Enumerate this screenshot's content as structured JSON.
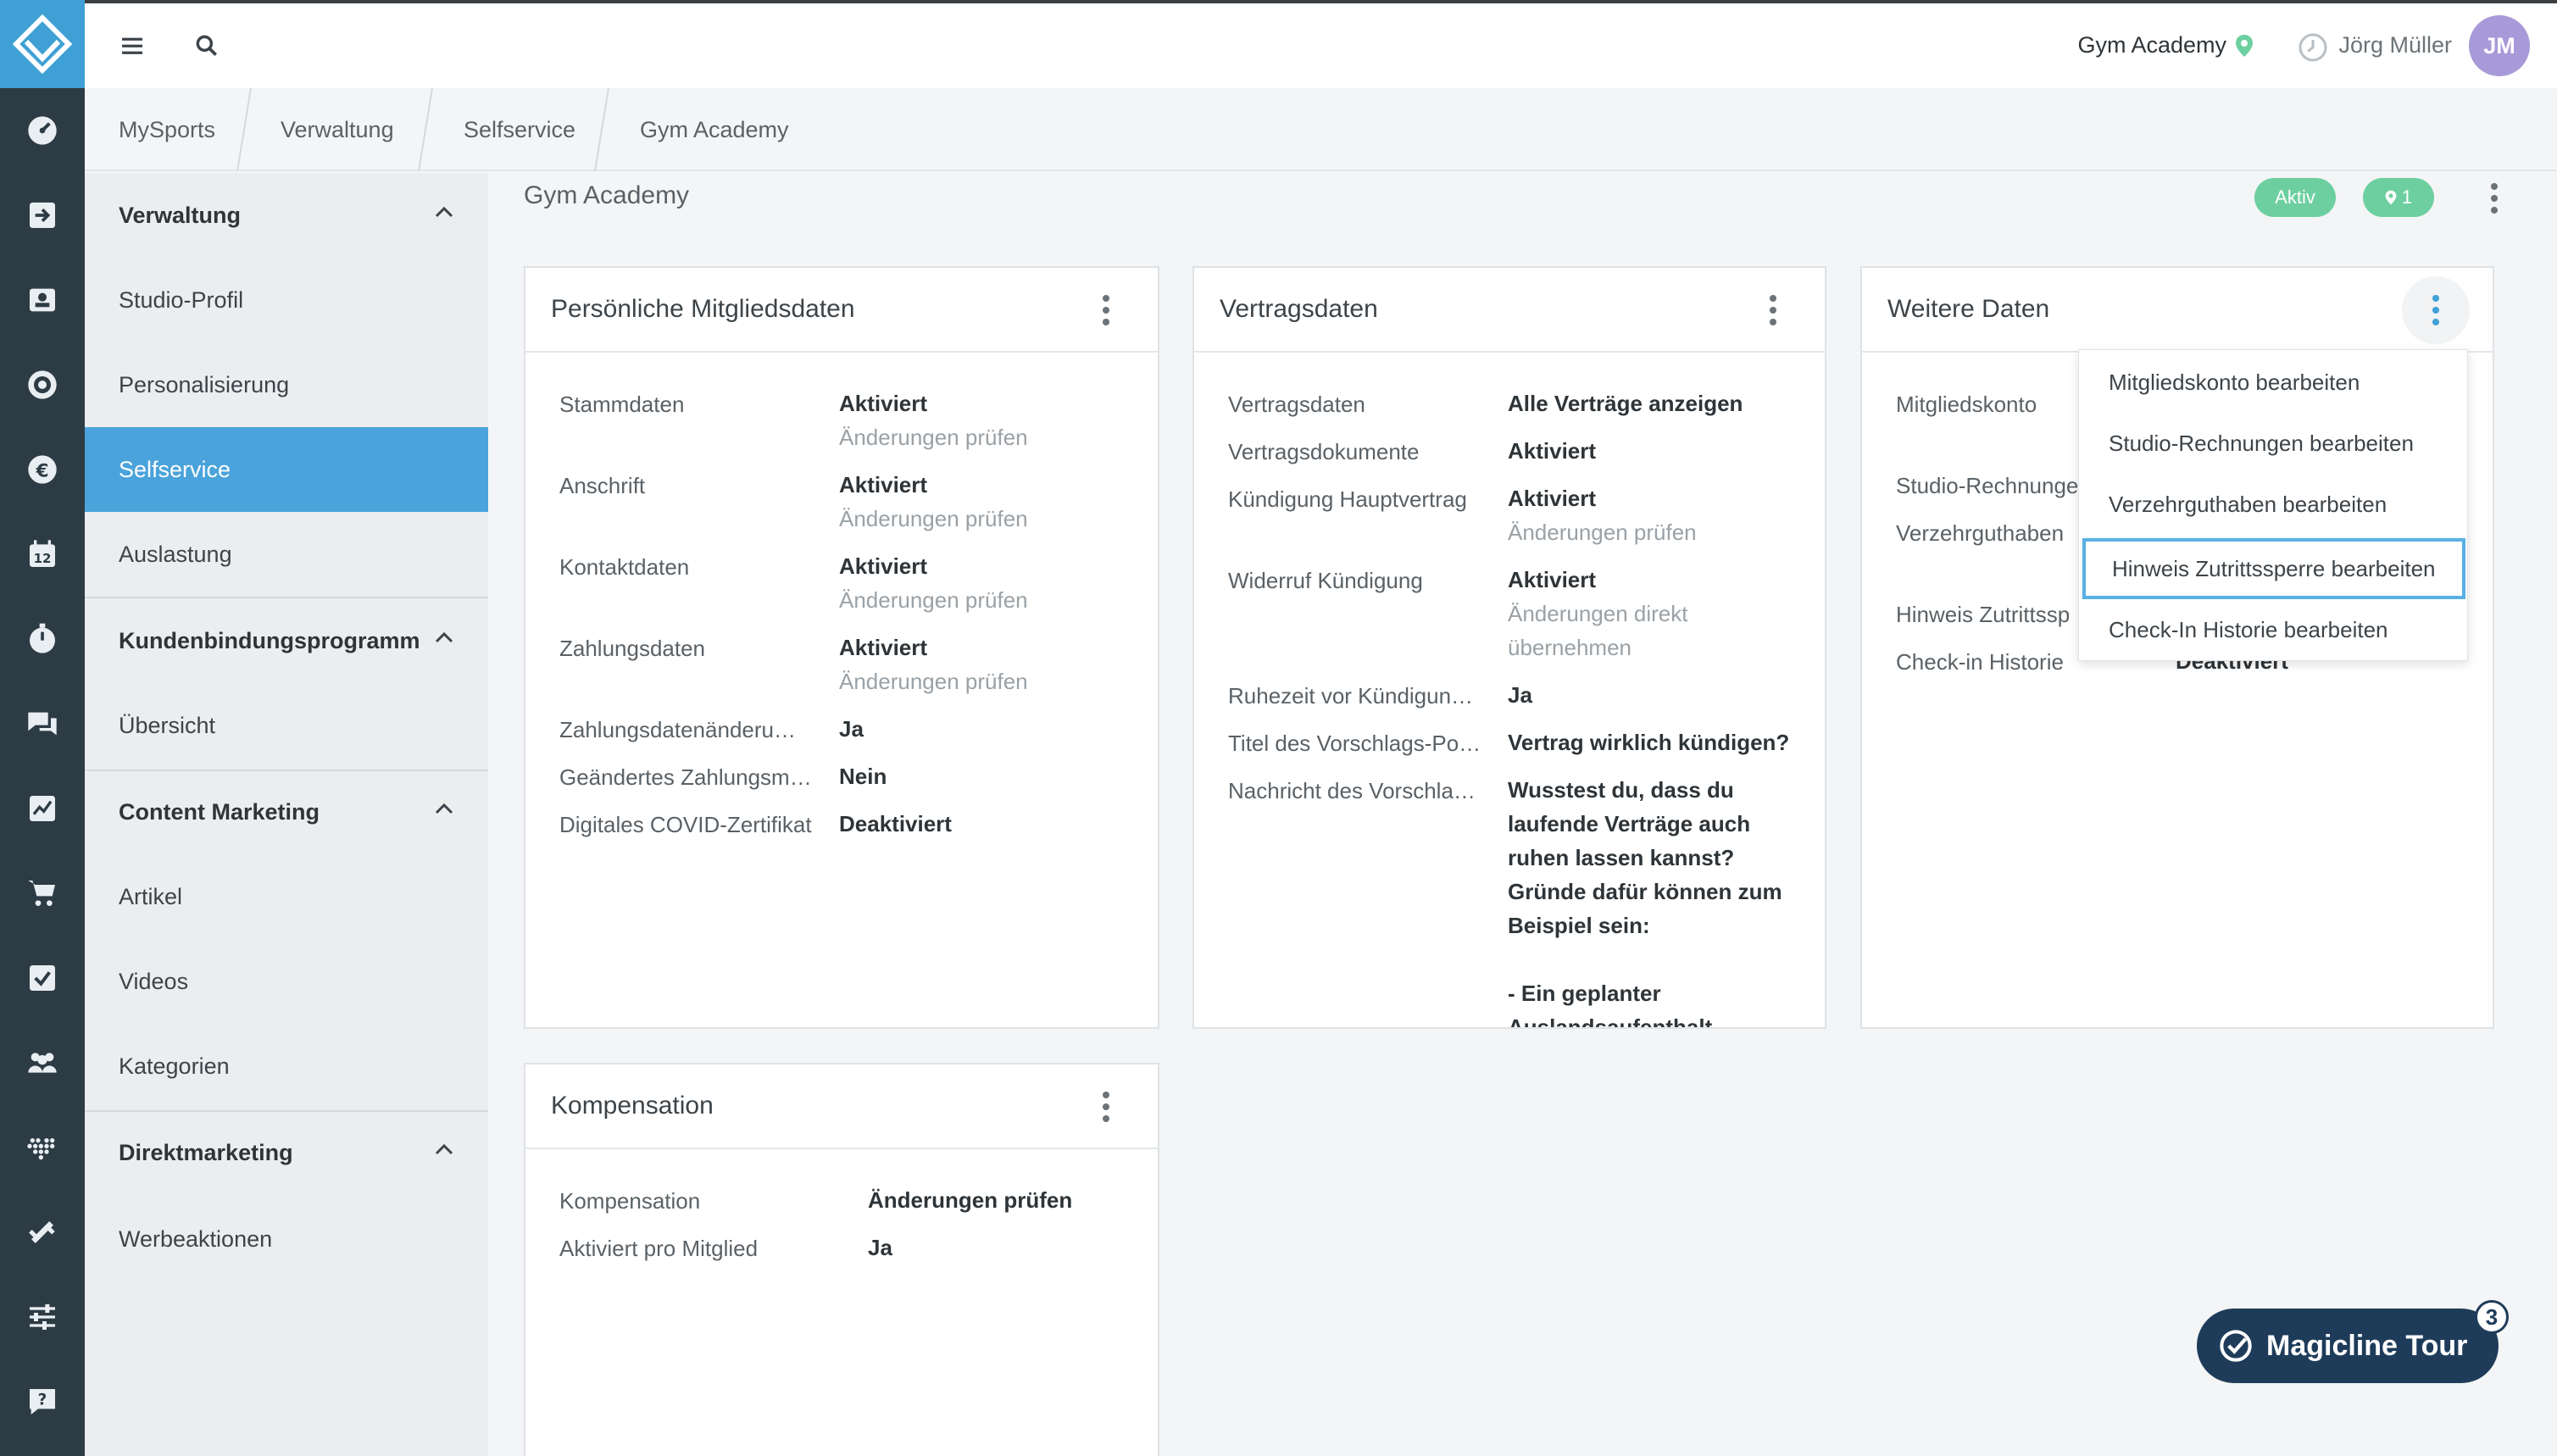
{
  "topbar": {
    "studio_name": "Gym Academy",
    "user_name": "Jörg Müller",
    "user_initials": "JM"
  },
  "breadcrumb": [
    "MySports",
    "Verwaltung",
    "Selfservice",
    "Gym Academy"
  ],
  "sidebar": {
    "groups": [
      {
        "title": "Verwaltung",
        "items": [
          "Studio-Profil",
          "Personalisierung",
          "Selfservice",
          "Auslastung"
        ]
      },
      {
        "title": "Kundenbindungsprogramm",
        "items": [
          "Übersicht"
        ]
      },
      {
        "title": "Content Marketing",
        "items": [
          "Artikel",
          "Videos",
          "Kategorien"
        ]
      },
      {
        "title": "Direktmarketing",
        "items": [
          "Werbeaktionen"
        ]
      }
    ],
    "active_item": "Selfservice"
  },
  "main": {
    "title": "Gym Academy",
    "status_badge": "Aktiv",
    "location_count": "1"
  },
  "cards": {
    "personal": {
      "title": "Persönliche Mitgliedsdaten",
      "rows": [
        {
          "label": "Stammdaten",
          "value": "Aktiviert",
          "sub": "Änderungen prüfen"
        },
        {
          "label": "Anschrift",
          "value": "Aktiviert",
          "sub": "Änderungen prüfen"
        },
        {
          "label": "Kontaktdaten",
          "value": "Aktiviert",
          "sub": "Änderungen prüfen"
        },
        {
          "label": "Zahlungsdaten",
          "value": "Aktiviert",
          "sub": "Änderungen prüfen"
        },
        {
          "label": "Zahlungsdatenänderu…",
          "value": "Ja"
        },
        {
          "label": "Geändertes Zahlungsm…",
          "value": "Nein"
        },
        {
          "label": "Digitales COVID-Zertifikat",
          "value": "Deaktiviert"
        }
      ]
    },
    "contract": {
      "title": "Vertragsdaten",
      "rows": [
        {
          "label": "Vertragsdaten",
          "value": "Alle Verträge anzeigen"
        },
        {
          "label": "Vertragsdokumente",
          "value": "Aktiviert"
        },
        {
          "label": "Kündigung Hauptvertrag",
          "value": "Aktiviert",
          "sub": "Änderungen prüfen"
        },
        {
          "label": "Widerruf Kündigung",
          "value": "Aktiviert",
          "sub1": "Änderungen direkt",
          "sub2": "übernehmen"
        },
        {
          "label": "Ruhezeit vor Kündigun…",
          "value": "Ja"
        },
        {
          "label": "Titel des Vorschlags-Po…",
          "value": "Vertrag wirklich kündigen?"
        },
        {
          "label": "Nachricht des Vorschla…",
          "lines": [
            "Wusstest du, dass du",
            "laufende Verträge auch",
            "ruhen lassen kannst?",
            "Gründe dafür können zum",
            "Beispiel sein:",
            "",
            "- Ein geplanter",
            "Auslandsaufenthalt"
          ]
        }
      ]
    },
    "further": {
      "title": "Weitere Daten",
      "rows": [
        {
          "label": "Mitgliedskonto"
        },
        {
          "label": "Studio-Rechnunge"
        },
        {
          "label": "Verzehrguthaben"
        },
        {
          "label": "Hinweis Zutrittssp"
        },
        {
          "label": "Check-in Historie",
          "value": "Deaktiviert"
        }
      ]
    },
    "compensation": {
      "title": "Kompensation",
      "rows": [
        {
          "label": "Kompensation",
          "value": "Änderungen prüfen"
        },
        {
          "label": "Aktiviert pro Mitglied",
          "value": "Ja"
        }
      ]
    }
  },
  "dropdown": {
    "items": [
      "Mitgliedskonto bearbeiten",
      "Studio-Rechnungen bearbeiten",
      "Verzehrguthaben bearbeiten",
      "Hinweis Zutrittssperre bearbeiten",
      "Check-In Historie bearbeiten"
    ],
    "focused_index": 3
  },
  "tour": {
    "label": "Magicline Tour",
    "count": "3"
  },
  "icons": {
    "rail": [
      "logo-icon",
      "dashboard-icon",
      "checkin-icon",
      "members-icon",
      "settings-circle-icon",
      "euro-icon",
      "calendar-icon",
      "timer-icon",
      "chat-icon",
      "chart-icon",
      "cart-icon",
      "tasks-icon",
      "groups-icon",
      "heart-dots-icon",
      "equipment-icon",
      "sliders-icon",
      "help-icon"
    ]
  },
  "colors": {
    "rail_bg": "#2d3b45",
    "accent": "#4aa3db",
    "status_green": "#6dcfa0",
    "tour_bg": "#1e3c5a"
  }
}
